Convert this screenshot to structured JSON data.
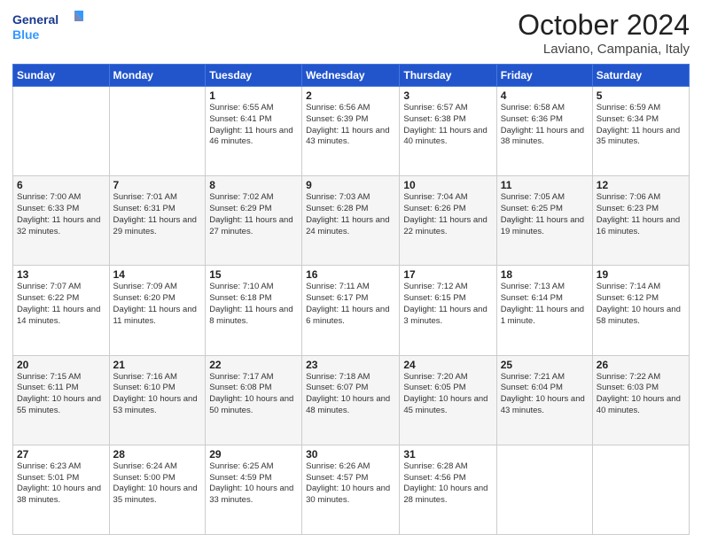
{
  "header": {
    "logo_general": "General",
    "logo_blue": "Blue",
    "month": "October 2024",
    "location": "Laviano, Campania, Italy"
  },
  "weekdays": [
    "Sunday",
    "Monday",
    "Tuesday",
    "Wednesday",
    "Thursday",
    "Friday",
    "Saturday"
  ],
  "weeks": [
    [
      {
        "day": "",
        "info": ""
      },
      {
        "day": "",
        "info": ""
      },
      {
        "day": "1",
        "info": "Sunrise: 6:55 AM\nSunset: 6:41 PM\nDaylight: 11 hours and 46 minutes."
      },
      {
        "day": "2",
        "info": "Sunrise: 6:56 AM\nSunset: 6:39 PM\nDaylight: 11 hours and 43 minutes."
      },
      {
        "day": "3",
        "info": "Sunrise: 6:57 AM\nSunset: 6:38 PM\nDaylight: 11 hours and 40 minutes."
      },
      {
        "day": "4",
        "info": "Sunrise: 6:58 AM\nSunset: 6:36 PM\nDaylight: 11 hours and 38 minutes."
      },
      {
        "day": "5",
        "info": "Sunrise: 6:59 AM\nSunset: 6:34 PM\nDaylight: 11 hours and 35 minutes."
      }
    ],
    [
      {
        "day": "6",
        "info": "Sunrise: 7:00 AM\nSunset: 6:33 PM\nDaylight: 11 hours and 32 minutes."
      },
      {
        "day": "7",
        "info": "Sunrise: 7:01 AM\nSunset: 6:31 PM\nDaylight: 11 hours and 29 minutes."
      },
      {
        "day": "8",
        "info": "Sunrise: 7:02 AM\nSunset: 6:29 PM\nDaylight: 11 hours and 27 minutes."
      },
      {
        "day": "9",
        "info": "Sunrise: 7:03 AM\nSunset: 6:28 PM\nDaylight: 11 hours and 24 minutes."
      },
      {
        "day": "10",
        "info": "Sunrise: 7:04 AM\nSunset: 6:26 PM\nDaylight: 11 hours and 22 minutes."
      },
      {
        "day": "11",
        "info": "Sunrise: 7:05 AM\nSunset: 6:25 PM\nDaylight: 11 hours and 19 minutes."
      },
      {
        "day": "12",
        "info": "Sunrise: 7:06 AM\nSunset: 6:23 PM\nDaylight: 11 hours and 16 minutes."
      }
    ],
    [
      {
        "day": "13",
        "info": "Sunrise: 7:07 AM\nSunset: 6:22 PM\nDaylight: 11 hours and 14 minutes."
      },
      {
        "day": "14",
        "info": "Sunrise: 7:09 AM\nSunset: 6:20 PM\nDaylight: 11 hours and 11 minutes."
      },
      {
        "day": "15",
        "info": "Sunrise: 7:10 AM\nSunset: 6:18 PM\nDaylight: 11 hours and 8 minutes."
      },
      {
        "day": "16",
        "info": "Sunrise: 7:11 AM\nSunset: 6:17 PM\nDaylight: 11 hours and 6 minutes."
      },
      {
        "day": "17",
        "info": "Sunrise: 7:12 AM\nSunset: 6:15 PM\nDaylight: 11 hours and 3 minutes."
      },
      {
        "day": "18",
        "info": "Sunrise: 7:13 AM\nSunset: 6:14 PM\nDaylight: 11 hours and 1 minute."
      },
      {
        "day": "19",
        "info": "Sunrise: 7:14 AM\nSunset: 6:12 PM\nDaylight: 10 hours and 58 minutes."
      }
    ],
    [
      {
        "day": "20",
        "info": "Sunrise: 7:15 AM\nSunset: 6:11 PM\nDaylight: 10 hours and 55 minutes."
      },
      {
        "day": "21",
        "info": "Sunrise: 7:16 AM\nSunset: 6:10 PM\nDaylight: 10 hours and 53 minutes."
      },
      {
        "day": "22",
        "info": "Sunrise: 7:17 AM\nSunset: 6:08 PM\nDaylight: 10 hours and 50 minutes."
      },
      {
        "day": "23",
        "info": "Sunrise: 7:18 AM\nSunset: 6:07 PM\nDaylight: 10 hours and 48 minutes."
      },
      {
        "day": "24",
        "info": "Sunrise: 7:20 AM\nSunset: 6:05 PM\nDaylight: 10 hours and 45 minutes."
      },
      {
        "day": "25",
        "info": "Sunrise: 7:21 AM\nSunset: 6:04 PM\nDaylight: 10 hours and 43 minutes."
      },
      {
        "day": "26",
        "info": "Sunrise: 7:22 AM\nSunset: 6:03 PM\nDaylight: 10 hours and 40 minutes."
      }
    ],
    [
      {
        "day": "27",
        "info": "Sunrise: 6:23 AM\nSunset: 5:01 PM\nDaylight: 10 hours and 38 minutes."
      },
      {
        "day": "28",
        "info": "Sunrise: 6:24 AM\nSunset: 5:00 PM\nDaylight: 10 hours and 35 minutes."
      },
      {
        "day": "29",
        "info": "Sunrise: 6:25 AM\nSunset: 4:59 PM\nDaylight: 10 hours and 33 minutes."
      },
      {
        "day": "30",
        "info": "Sunrise: 6:26 AM\nSunset: 4:57 PM\nDaylight: 10 hours and 30 minutes."
      },
      {
        "day": "31",
        "info": "Sunrise: 6:28 AM\nSunset: 4:56 PM\nDaylight: 10 hours and 28 minutes."
      },
      {
        "day": "",
        "info": ""
      },
      {
        "day": "",
        "info": ""
      }
    ]
  ]
}
